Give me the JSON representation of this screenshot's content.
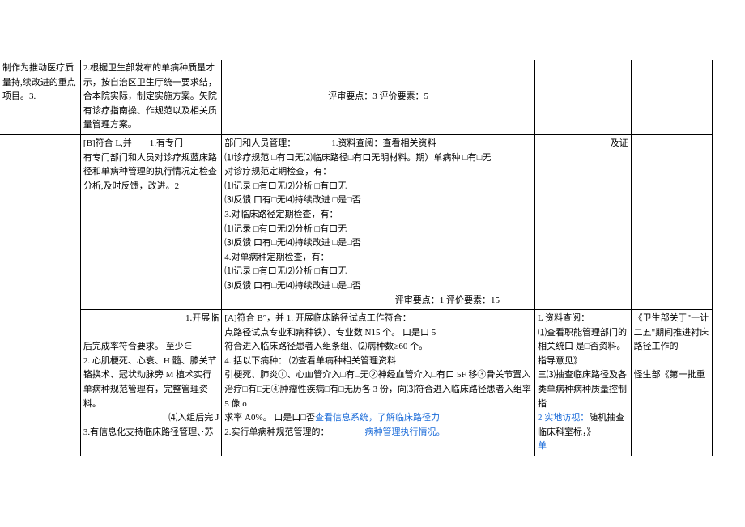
{
  "row1": {
    "c1": "制作为推动医疗质量持,续改进的重点项目。3.",
    "c2": "2.根据卫生部发布的单病种质量才示，按自治区卫生厅统一要求结，合本院实际，制定实施方案。矢院有诊疗指南操、作规范以及相关质量管理方案。",
    "c3": "评审要点：3 评价要素：5",
    "c4": "",
    "c5": ""
  },
  "row2": {
    "c2a": "[B]符合 L,并",
    "c2b": "1.有专门",
    "c2c": "有专门部门和人员对诊疗规蓝床路径和单病种管理的执行情况定检查分析,及时反馈，改进。2",
    "c3_a": "部门和人员管理：",
    "c3_b": "1.资料查阅：查看相关资料",
    "c3_1": "⑴诊疗规范    □有口无⑵临床路径□有口无明材料。期）单病种    □有□无",
    "c3_2": "对诊疗规范定期检查，有：",
    "c3_21": "⑴记录    □有口无⑵分析    □有口无",
    "c3_22": "⑶反馈    口有□无⑷持续改进    □是□否",
    "c3_3": "3.对临床路径定期检查，有：",
    "c3_31": "⑴记录    □有口无⑵分析    □有口无",
    "c3_32": "⑶反馈    口有□无⑷持续改进    □是□否",
    "c3_4": "4.对单病种定期检查，有：",
    "c3_41": "⑴记录    □有口无⑵分析    □有口无",
    "c3_42": "⑶反馈    口有□无⑷持续改进    □是□否",
    "c3_foot": "评审要点：1 评价要素：15",
    "c4": "及证"
  },
  "row3": {
    "c2_1": "1.开展临",
    "c2_2": "后完成率符合要求。    至少∈",
    "c2_3": "2. 心肌梗死、心衰、H 髓、膝关节铬换术、冠状动脉旁 M 植术实行单病种规范管理有，完整管理资料。",
    "c2_4": "⑷入组后完 J",
    "c2_5": "3.有信息化支持临床路径管理、·苏",
    "c3_h": "[A]符合 B°，并    1. 开展临床路径试点工作符合：",
    "c3_1": "点路径试点专业和病种铁）、专业数 N15 个。    口是口 5",
    "c3_2": "符合进入临床路径患者入组条组、⑵病种数≥60 个。",
    "c3_3": "4. 括以下病种：    ⑵查看单病种相关管理资料",
    "c3_4": "引梗死、肺炎①、心血管介入□有□无②神经血管介入□有口 5F 移③骨关节置入治疗□有□无④肿瘤性疾病□有□无历各 3 份，向⑶符合进入临床路径患者入组率 5 像 o",
    "c3_5": "求率 A0%。    口是口□否",
    "c3_5b": "查看信息系统，了解临床路径力",
    "c3_6": "2.实行单病种规范管理的：",
    "c3_6b": "病种管理执行情况。",
    "c4_1": "L 资料查阅：",
    "c4_2": "⑴查看职能管理部门的相关统口    是□否资料。",
    "c4_3": "指导意见》",
    "c4_4": "三⑶抽查临床路径及各类单病种病种质量控制指",
    "c4_5": "随机抽查临床科室标，》",
    "c4_5b": "2 实地访视：",
    "c4_6": "单",
    "c5_1": "《卫生部关于\"一计二五\"期间推进衬床路径工作的",
    "c5_2": "怪生部《第一批重"
  }
}
